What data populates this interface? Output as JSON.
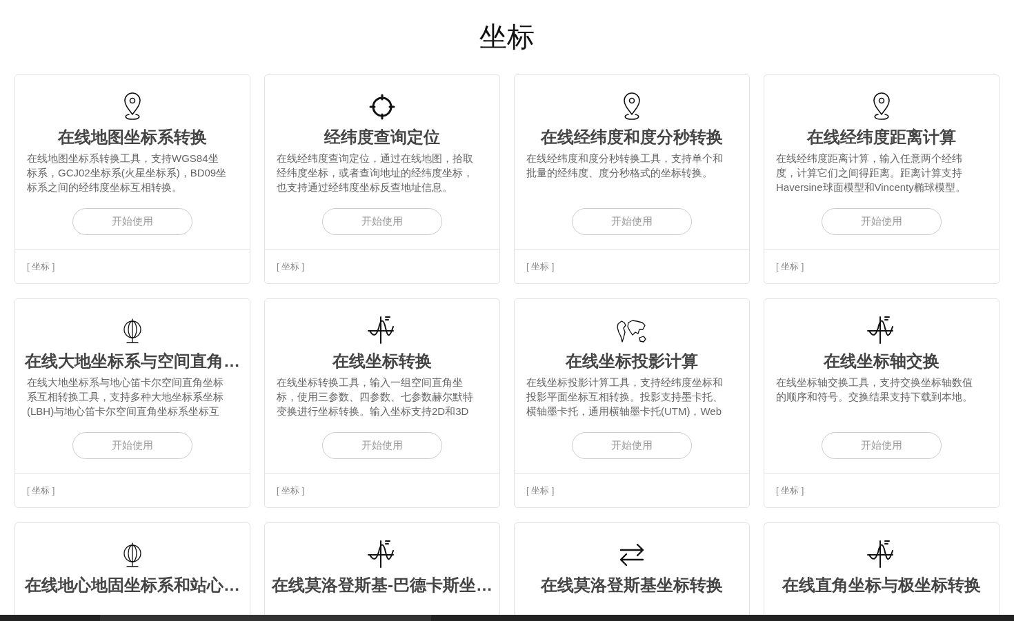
{
  "page_title": "坐标",
  "cards": [
    {
      "kind": "pin",
      "title": "在线地图坐标系转换",
      "description": [
        "在线地图坐标系转换工具，支持WGS84坐",
        "标系，GCJ02坐标系(火星坐标系)，BD09坐",
        "标系之间的经纬度坐标互相转换。"
      ],
      "button": "开始使用",
      "tag": "[ 坐标 ]"
    },
    {
      "kind": "crosshair",
      "title": "经纬度查询定位",
      "description": [
        "在线经纬度查询定位，通过在线地图，拾取",
        "经纬度坐标，或者查询地址的经纬度坐标，",
        "也支持通过经纬度坐标反查地址信息。"
      ],
      "button": "开始使用",
      "tag": "[ 坐标 ]"
    },
    {
      "kind": "pin",
      "title": "在线经纬度和度分秒转换",
      "description": [
        "在线经纬度和度分秒转换工具，支持单个和",
        "批量的经纬度、度分秒格式的坐标转换。"
      ],
      "button": "开始使用",
      "tag": "[ 坐标 ]"
    },
    {
      "kind": "pin",
      "title": "在线经纬度距离计算",
      "description": [
        "在线经纬度距离计算，输入任意两个经纬",
        "度，计算它们之间得距离。距离计算支持",
        "Haversine球面模型和Vincenty椭球模型。"
      ],
      "button": "开始使用",
      "tag": "[ 坐标 ]"
    },
    {
      "kind": "globe",
      "title": "在线大地坐标系与空间直角…",
      "description": [
        "在线大地坐标系与地心笛卡尔空间直角坐标",
        "系互相转换工具，支持多种大地坐标系坐标",
        "(LBH)与地心笛卡尔空间直角坐标系坐标互"
      ],
      "button": "开始使用",
      "tag": "[ 坐标 ]"
    },
    {
      "kind": "wave",
      "title": "在线坐标转换",
      "description": [
        "在线坐标转换工具，输入一组空间直角坐",
        "标，使用三参数、四参数、七参数赫尔默特",
        "变换进行坐标转换。输入坐标支持2D和3D"
      ],
      "button": "开始使用",
      "tag": "[ 坐标 ]"
    },
    {
      "kind": "map",
      "title": "在线坐标投影计算",
      "description": [
        "在线坐标投影计算工具，支持经纬度坐标和",
        "投影平面坐标互相转换。投影支持墨卡托、",
        "横轴墨卡托，通用横轴墨卡托(UTM)，Web"
      ],
      "button": "开始使用",
      "tag": "[ 坐标 ]"
    },
    {
      "kind": "wave",
      "title": "在线坐标轴交换",
      "description": [
        "在线坐标轴交换工具，支持交换坐标轴数值",
        "的顺序和符号。交换结果支持下载到本地。"
      ],
      "button": "开始使用",
      "tag": "[ 坐标 ]"
    },
    {
      "kind": "globe",
      "title": "在线地心地固坐标系和站心…"
    },
    {
      "kind": "wave",
      "title": "在线莫洛登斯基-巴德卡斯坐…"
    },
    {
      "kind": "arrows",
      "title": "在线莫洛登斯基坐标转换"
    },
    {
      "kind": "wave",
      "title": "在线直角坐标与极坐标转换"
    }
  ]
}
